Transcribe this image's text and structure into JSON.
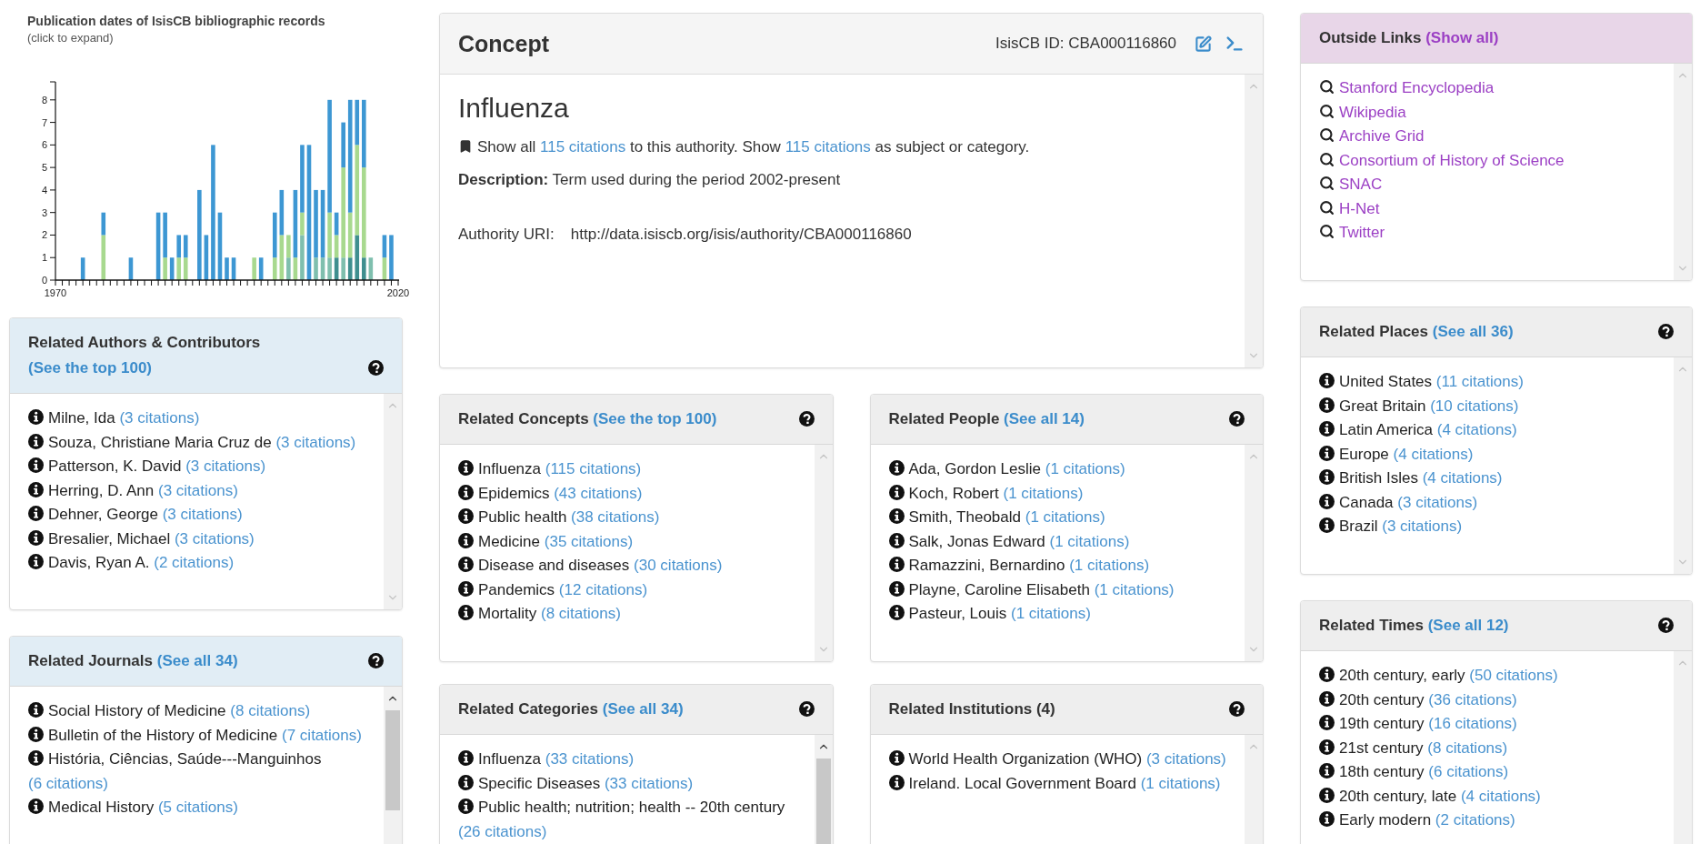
{
  "left_column": {
    "chart": {
      "title": "Publication dates of IsisCB bibliographic records",
      "subtitle": "(click to expand)",
      "chart_data": {
        "type": "bar",
        "stacked": true,
        "xlim": [
          1970,
          2020
        ],
        "ylim": [
          0,
          8.8
        ],
        "xticks": [
          1970,
          2020
        ],
        "yticks": [
          0,
          1,
          2,
          3,
          4,
          5,
          6,
          7,
          8
        ],
        "x": [
          1974,
          1977,
          1981,
          1985,
          1986,
          1987,
          1988,
          1989,
          1991,
          1992,
          1993,
          1994,
          1995,
          1996,
          1999,
          2000,
          2002,
          2003,
          2004,
          2005,
          2006,
          2007,
          2008,
          2009,
          2010,
          2011,
          2012,
          2013,
          2014,
          2015,
          2016,
          2018,
          2019
        ],
        "series": [
          {
            "color": "#3f8f8f",
            "values": [
              0,
              0,
              0,
              0,
              0,
              0,
              0,
              0,
              0,
              0,
              0,
              0,
              0,
              0,
              0,
              0,
              0,
              0,
              0,
              0,
              0,
              0,
              0,
              0,
              0,
              1,
              0,
              1,
              2,
              1,
              0,
              0,
              0
            ]
          },
          {
            "color": "#7fbfae",
            "values": [
              0,
              0,
              0,
              0,
              0,
              0,
              0,
              0,
              0,
              0,
              0,
              0,
              0,
              0,
              0,
              0,
              0,
              0,
              1,
              0,
              2,
              0,
              1,
              1,
              1,
              0,
              1,
              0,
              0,
              0,
              1,
              0,
              0
            ]
          },
          {
            "color": "#a8d98f",
            "values": [
              0,
              2,
              0,
              0,
              1,
              0,
              1,
              1,
              0,
              0,
              0,
              0,
              0,
              0,
              1,
              0,
              1,
              2,
              1,
              1,
              1,
              0,
              0,
              0,
              2,
              1,
              4,
              2,
              4,
              4,
              0,
              1,
              0
            ]
          },
          {
            "color": "#3d97d3",
            "values": [
              1,
              1,
              1,
              3,
              2,
              1,
              1,
              1,
              4,
              2,
              6,
              3,
              1,
              1,
              0,
              1,
              2,
              2,
              0,
              3,
              3,
              6,
              3,
              3,
              5,
              1,
              2,
              5,
              2,
              3,
              0,
              1,
              2
            ]
          }
        ]
      }
    },
    "panels": [
      {
        "kind": "highlighted",
        "title": "Related Authors & Contributors",
        "link": "(See the top 100)",
        "overflows": false,
        "items": [
          {
            "name": "Milne, Ida",
            "count": "(3 citations)"
          },
          {
            "name": "Souza, Christiane Maria Cruz de",
            "count": "(3 citations)"
          },
          {
            "name": "Patterson, K. David",
            "count": "(3 citations)"
          },
          {
            "name": "Herring, D. Ann",
            "count": "(3 citations)"
          },
          {
            "name": "Dehner, George",
            "count": "(3 citations)"
          },
          {
            "name": "Bresalier, Michael",
            "count": "(3 citations)"
          },
          {
            "name": "Davis, Ryan A.",
            "count": "(2 citations)"
          }
        ]
      },
      {
        "kind": "highlighted",
        "title": "Related Journals",
        "link": "(See all 34)",
        "overflows": true,
        "items": [
          {
            "name": "Social History of Medicine",
            "count": "(8 citations)"
          },
          {
            "name": "Bulletin of the History of Medicine",
            "count": "(7 citations)"
          },
          {
            "name": "História, Ciências, Saúde---Manguinhos",
            "count": "(6 citations)"
          },
          {
            "name": "Medical History",
            "count": "(5 citations)"
          }
        ]
      }
    ]
  },
  "center_column": {
    "concept": {
      "title": "Concept",
      "id_label": "IsisCB ID: CBA000116860",
      "name": "Influenza",
      "citations_line": [
        {
          "kind": "text",
          "text": "Show all "
        },
        {
          "kind": "link",
          "text": "115 citations"
        },
        {
          "kind": "text",
          "text": " to this authority. Show "
        },
        {
          "kind": "link",
          "text": "115 citations"
        },
        {
          "kind": "text",
          "text": " as subject or category."
        }
      ],
      "description_label": "Description:",
      "description": "Term used during the period 2002-present",
      "uri_label": "Authority URI:",
      "uri": "http://data.isiscb.org/isis/authority/CBA000116860"
    },
    "panels": [
      {
        "kind": "plain",
        "title": "Related Concepts",
        "link": "(See the top 100)",
        "overflows": false,
        "items": [
          {
            "name": "Influenza",
            "count": "(115 citations)"
          },
          {
            "name": "Epidemics",
            "count": "(43 citations)"
          },
          {
            "name": "Public health",
            "count": "(38 citations)"
          },
          {
            "name": "Medicine",
            "count": "(35 citations)"
          },
          {
            "name": "Disease and diseases",
            "count": "(30 citations)"
          },
          {
            "name": "Pandemics",
            "count": "(12 citations)"
          },
          {
            "name": "Mortality",
            "count": "(8 citations)"
          }
        ]
      },
      {
        "kind": "plain",
        "title": "Related People",
        "link": "(See all 14)",
        "overflows": false,
        "items": [
          {
            "name": "Ada, Gordon Leslie",
            "count": "(1 citations)"
          },
          {
            "name": "Koch, Robert",
            "count": "(1 citations)"
          },
          {
            "name": "Smith, Theobald",
            "count": "(1 citations)"
          },
          {
            "name": "Salk, Jonas Edward",
            "count": "(1 citations)"
          },
          {
            "name": "Ramazzini, Bernardino",
            "count": "(1 citations)"
          },
          {
            "name": "Playne, Caroline Elisabeth",
            "count": "(1 citations)"
          },
          {
            "name": "Pasteur, Louis",
            "count": "(1 citations)"
          }
        ]
      },
      {
        "kind": "plain",
        "title": "Related Categories",
        "link": "(See all 34)",
        "overflows": true,
        "items": [
          {
            "name": "Influenza",
            "count": "(33 citations)"
          },
          {
            "name": "Specific Diseases",
            "count": "(33 citations)"
          },
          {
            "name": "Public health; nutrition; health -- 20th century",
            "count": "(26 citations)"
          }
        ]
      },
      {
        "kind": "plain",
        "title": "Related Institutions (4)",
        "overflows": false,
        "items": [
          {
            "name": "World Health Organization (WHO)",
            "count": "(3 citations)"
          },
          {
            "name": "Ireland. Local Government Board",
            "count": "(1 citations)"
          }
        ]
      }
    ]
  },
  "right_column": {
    "outside_links": {
      "title": "Outside Links",
      "link": "(Show all)",
      "links": [
        "Stanford Encyclopedia",
        "Wikipedia",
        "Archive Grid",
        "Consortium of History of Science",
        "SNAC",
        "H-Net",
        "Twitter"
      ]
    },
    "panels": [
      {
        "kind": "plain",
        "title": "Related Places",
        "link": "(See all 36)",
        "overflows": false,
        "items": [
          {
            "name": "United States",
            "count": "(11 citations)"
          },
          {
            "name": "Great Britain",
            "count": "(10 citations)"
          },
          {
            "name": "Latin America",
            "count": "(4 citations)"
          },
          {
            "name": "Europe",
            "count": "(4 citations)"
          },
          {
            "name": "British Isles",
            "count": "(4 citations)"
          },
          {
            "name": "Canada",
            "count": "(3 citations)"
          },
          {
            "name": "Brazil",
            "count": "(3 citations)"
          }
        ]
      },
      {
        "kind": "plain",
        "title": "Related Times",
        "link": "(See all 12)",
        "overflows": false,
        "items": [
          {
            "name": "20th century, early",
            "count": "(50 citations)"
          },
          {
            "name": "20th century",
            "count": "(36 citations)"
          },
          {
            "name": "19th century",
            "count": "(16 citations)"
          },
          {
            "name": "21st century",
            "count": "(8 citations)"
          },
          {
            "name": "18th century",
            "count": "(6 citations)"
          },
          {
            "name": "20th century, late",
            "count": "(4 citations)"
          },
          {
            "name": "Early modern",
            "count": "(2 citations)"
          }
        ]
      }
    ]
  }
}
